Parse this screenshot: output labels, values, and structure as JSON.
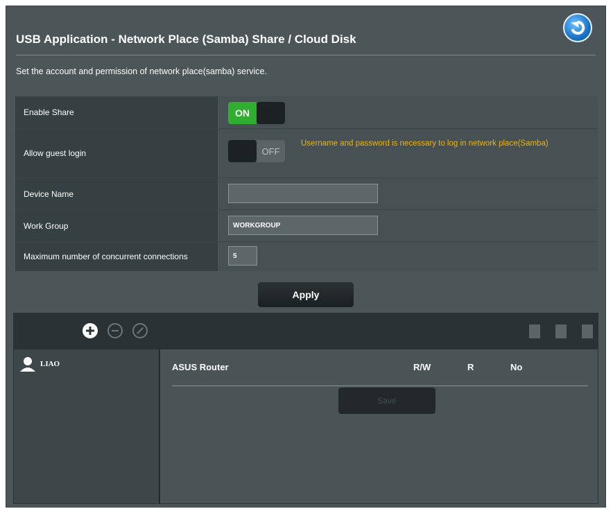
{
  "header": {
    "title": "USB Application - Network Place (Samba) Share / Cloud Disk",
    "description": "Set the account and permission of network place(samba) service.",
    "back_icon": "back-arrow-icon"
  },
  "settings": {
    "enable_share": {
      "label": "Enable Share",
      "state": "ON"
    },
    "allow_guest": {
      "label": "Allow guest login",
      "state": "OFF",
      "note": "Username and password is necessary to log in network place(Samba)"
    },
    "device_name": {
      "label": "Device Name",
      "value": ""
    },
    "work_group": {
      "label": "Work Group",
      "value": "WORKGROUP"
    },
    "max_connections": {
      "label": "Maximum number of concurrent connections",
      "value": "5"
    }
  },
  "apply_label": "Apply",
  "toolbar": {
    "icons": [
      "add-icon",
      "remove-icon",
      "modify-icon",
      "add-folder-icon",
      "delete-folder-icon",
      "edit-folder-icon"
    ]
  },
  "users": [
    {
      "name": "LIAO",
      "icon": "user-icon"
    }
  ],
  "permissions": {
    "device": "ASUS Router",
    "columns": [
      "R/W",
      "R",
      "No"
    ],
    "save_label": "Save"
  },
  "colors": {
    "panel": "#4c5659",
    "toggle_on": "#2fae2f",
    "note": "#f2b400",
    "back_button": "#1a74c9"
  }
}
